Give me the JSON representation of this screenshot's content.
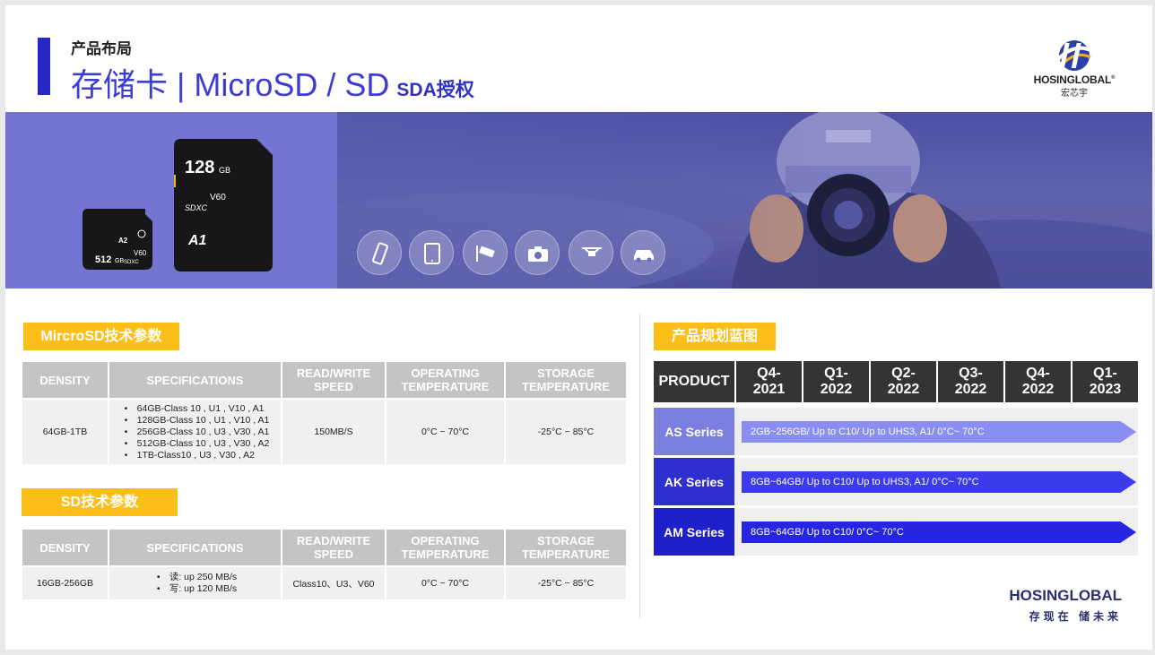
{
  "header": {
    "subtitle": "产品布局",
    "title": "存储卡 | MicroSD / SD",
    "title_tag": "SDA授权"
  },
  "logo": {
    "name": "HOSINGLOBAL",
    "reg": "®",
    "cn": "宏芯宇"
  },
  "banner": {
    "sd_card": {
      "capacity": "128",
      "unit": "GB",
      "marks": "V60",
      "sdxc": "SDXC",
      "a1": "A1"
    },
    "micro_card": {
      "capacity": "512",
      "unit": "GB",
      "a2": "A2",
      "v60": "V60",
      "sdxc": "SDXC"
    },
    "icons": [
      "phone-icon",
      "tablet-icon",
      "security-camera-icon",
      "camera-icon",
      "drone-icon",
      "car-icon"
    ]
  },
  "microsd": {
    "label": "MircroSD技术参数",
    "headers": [
      "DENSITY",
      "SPECIFICATIONS",
      "READ/WRITE SPEED",
      "OPERATING TEMPERATURE",
      "STORAGE TEMPERATURE"
    ],
    "row": {
      "density": "64GB-1TB",
      "specs": [
        "64GB-Class 10 , U1 , V10 , A1",
        "128GB-Class 10 , U1 , V10 , A1",
        "256GB-Class 10 , U3 , V30 , A1",
        "512GB-Class 10 , U3 , V30 , A2",
        "1TB-Class10 , U3 , V30 , A2"
      ],
      "speed": "150MB/S",
      "operating": "0°C ~ 70°C",
      "storage": "-25°C ~ 85°C"
    }
  },
  "sd": {
    "label": "SD技术参数",
    "headers": [
      "DENSITY",
      "SPECIFICATIONS",
      "READ/WRITE SPEED",
      "OPERATING TEMPERATURE",
      "STORAGE TEMPERATURE"
    ],
    "row": {
      "density": "16GB-256GB",
      "specs": [
        "读: up 250 MB/s",
        "写: up 120 MB/s"
      ],
      "speed": "Class10、U3、V60",
      "operating": "0°C ~ 70°C",
      "storage": "-25°C ~ 85°C"
    }
  },
  "roadmap": {
    "label": "产品规划蓝图",
    "product_header": "PRODUCT",
    "quarters": [
      {
        "q": "Q4-",
        "y": "2021"
      },
      {
        "q": "Q1-",
        "y": "2022"
      },
      {
        "q": "Q2-",
        "y": "2022"
      },
      {
        "q": "Q3-",
        "y": "2022"
      },
      {
        "q": "Q4-",
        "y": "2022"
      },
      {
        "q": "Q1-",
        "y": "2023"
      }
    ],
    "rows": [
      {
        "name": "AS Series",
        "text": "2GB~256GB/ Up to C10/ Up to UHS3, A1/ 0°C~ 70°C",
        "name_color": "#7b7fdd",
        "bar_color": "#8a8ef0"
      },
      {
        "name": "AK Series",
        "text": "8GB~64GB/ Up to C10/ Up to UHS3, A1/ 0°C~ 70°C",
        "name_color": "#2f2fd0",
        "bar_color": "#3b3bec"
      },
      {
        "name": "AM Series",
        "text": "8GB~64GB/ Up to C10/ 0°C~ 70°C",
        "name_color": "#1f1fcb",
        "bar_color": "#2626e0"
      }
    ]
  },
  "footer": {
    "name": "HOSINGLOBAL",
    "cn": "存现在 储未来"
  }
}
